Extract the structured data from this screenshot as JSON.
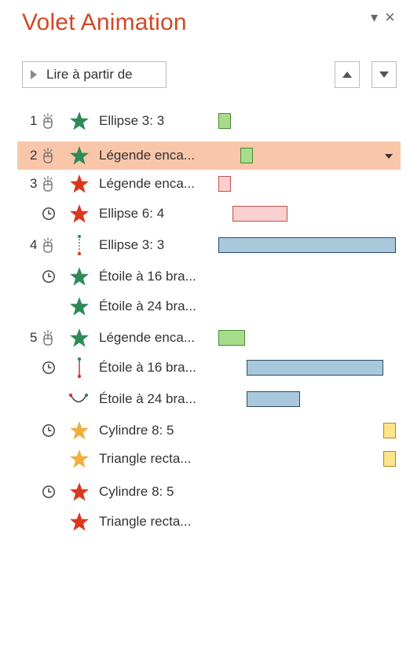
{
  "pane": {
    "title": "Volet Animation",
    "pin_icon": "▾",
    "close_icon": "×"
  },
  "toolbar": {
    "play_label": "Lire à partir de"
  },
  "colors": {
    "title": "#d24726",
    "selected_row": "#f9c6aa",
    "green": "#2e8b57",
    "red": "#d9381e",
    "yellow": "#f0b040"
  },
  "rows": [
    {
      "num": "1",
      "trigger": "mouse",
      "effect": "star-green",
      "name": "Ellipse 3: 3",
      "bar": "green"
    },
    {
      "num": "2",
      "trigger": "mouse",
      "effect": "star-green",
      "name": "Légende enca...",
      "bar": "green",
      "selected": true
    },
    {
      "num": "3",
      "trigger": "mouse",
      "effect": "star-red",
      "name": "Légende enca...",
      "bar": "pink"
    },
    {
      "num": "",
      "trigger": "clock",
      "effect": "star-red",
      "name": "Ellipse 6: 4",
      "bar": "pink"
    },
    {
      "num": "4",
      "trigger": "mouse",
      "effect": "motion-dotted",
      "name": "Ellipse 3: 3",
      "bar": "blue"
    },
    {
      "num": "",
      "trigger": "clock",
      "effect": "star-green",
      "name": "Étoile à 16 bra...",
      "bar": ""
    },
    {
      "num": "",
      "trigger": "",
      "effect": "star-green",
      "name": "Étoile à 24 bra...",
      "bar": ""
    },
    {
      "num": "5",
      "trigger": "mouse",
      "effect": "star-green",
      "name": "Légende enca...",
      "bar": "green"
    },
    {
      "num": "",
      "trigger": "clock",
      "effect": "motion-line",
      "name": "Étoile à 16 bra...",
      "bar": "blue"
    },
    {
      "num": "",
      "trigger": "",
      "effect": "motion-arc",
      "name": "Étoile à 24 bra...",
      "bar": "blue"
    },
    {
      "num": "",
      "trigger": "clock",
      "effect": "star-yellow",
      "name": "Cylindre 8: 5",
      "bar": "yellow"
    },
    {
      "num": "",
      "trigger": "",
      "effect": "star-yellow",
      "name": "Triangle recta...",
      "bar": "yellow"
    },
    {
      "num": "",
      "trigger": "clock",
      "effect": "star-red",
      "name": "Cylindre 8: 5",
      "bar": ""
    },
    {
      "num": "",
      "trigger": "",
      "effect": "star-red",
      "name": "Triangle recta...",
      "bar": ""
    }
  ]
}
